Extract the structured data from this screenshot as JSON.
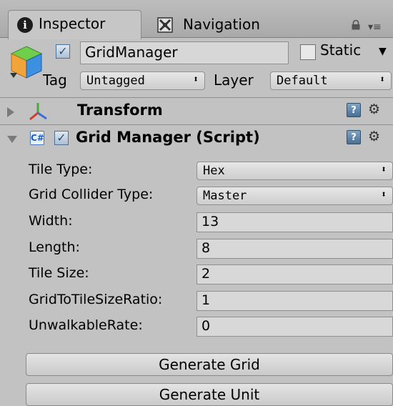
{
  "tabs": [
    {
      "label": "Inspector",
      "icon": "info-icon"
    },
    {
      "label": "Navigation",
      "icon": "navigation-icon"
    }
  ],
  "header": {
    "object_name": "GridManager",
    "static_label": "Static",
    "tag_label": "Tag",
    "tag_value": "Untagged",
    "layer_label": "Layer",
    "layer_value": "Default"
  },
  "components": {
    "transform": {
      "title": "Transform"
    },
    "grid_manager": {
      "title": "Grid Manager (Script)"
    }
  },
  "properties": [
    {
      "label": "Tile Type:",
      "value": "Hex"
    },
    {
      "label": "Grid Collider Type:",
      "value": "Master"
    },
    {
      "label": "Width:",
      "value": "13"
    },
    {
      "label": "Length:",
      "value": "8"
    },
    {
      "label": "Tile Size:",
      "value": "2"
    },
    {
      "label": "GridToTileSizeRatio:",
      "value": "1"
    },
    {
      "label": "UnwalkableRate:",
      "value": "0"
    }
  ],
  "buttons": {
    "generate_grid": "Generate Grid",
    "generate_unit": "Generate Unit"
  },
  "colors": {
    "panel_bg": "#c2c2c2",
    "checkbox_check": "#2c4f79",
    "transform_x": "#d33b2c",
    "transform_y": "#4aa83a",
    "transform_z": "#3b6fd3"
  }
}
